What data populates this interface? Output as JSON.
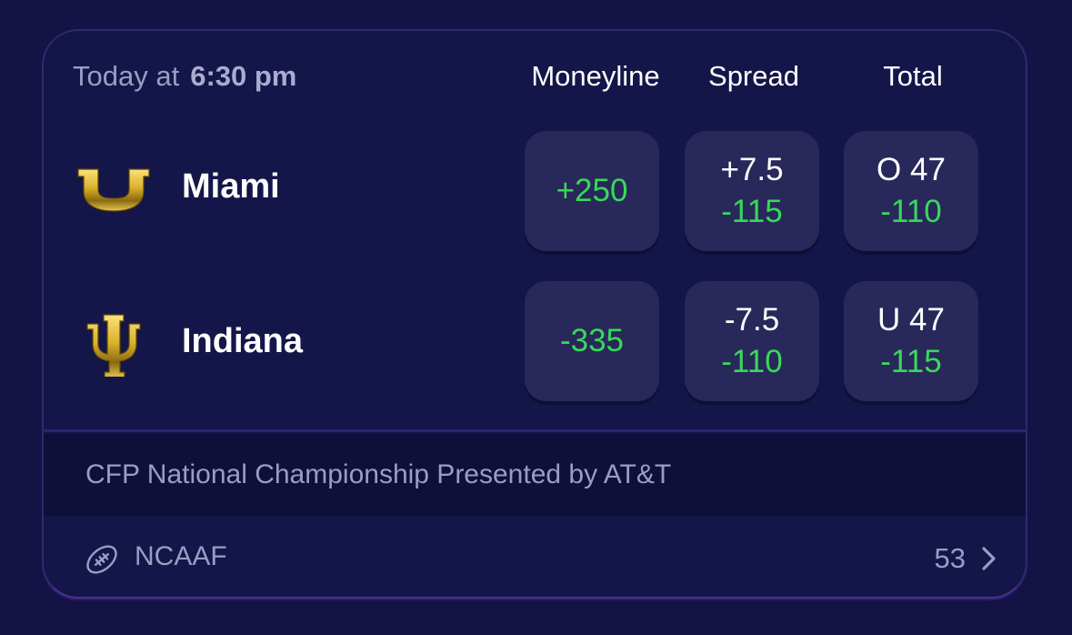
{
  "header": {
    "day": "Today at",
    "time": "6:30 pm",
    "columns": {
      "moneyline": "Moneyline",
      "spread": "Spread",
      "total": "Total"
    }
  },
  "teams": [
    {
      "name": "Miami",
      "logo": "miami-u-logo",
      "moneyline": "+250",
      "spread": {
        "line": "+7.5",
        "price": "-115"
      },
      "total": {
        "line": "O 47",
        "price": "-110"
      }
    },
    {
      "name": "Indiana",
      "logo": "indiana-iu-logo",
      "moneyline": "-335",
      "spread": {
        "line": "-7.5",
        "price": "-110"
      },
      "total": {
        "line": "U 47",
        "price": "-115"
      }
    }
  ],
  "event": {
    "title": "CFP National Championship Presented by AT&T"
  },
  "footer": {
    "league": "NCAAF",
    "league_icon": "football-icon",
    "more_count": "53",
    "more_icon": "chevron-right-icon"
  },
  "colors": {
    "background": "#131445",
    "card": "#141548",
    "button": "#28285a",
    "price_green": "#38d95a",
    "muted_text": "#9a9dc3",
    "logo_gold": "#d9b02a"
  }
}
